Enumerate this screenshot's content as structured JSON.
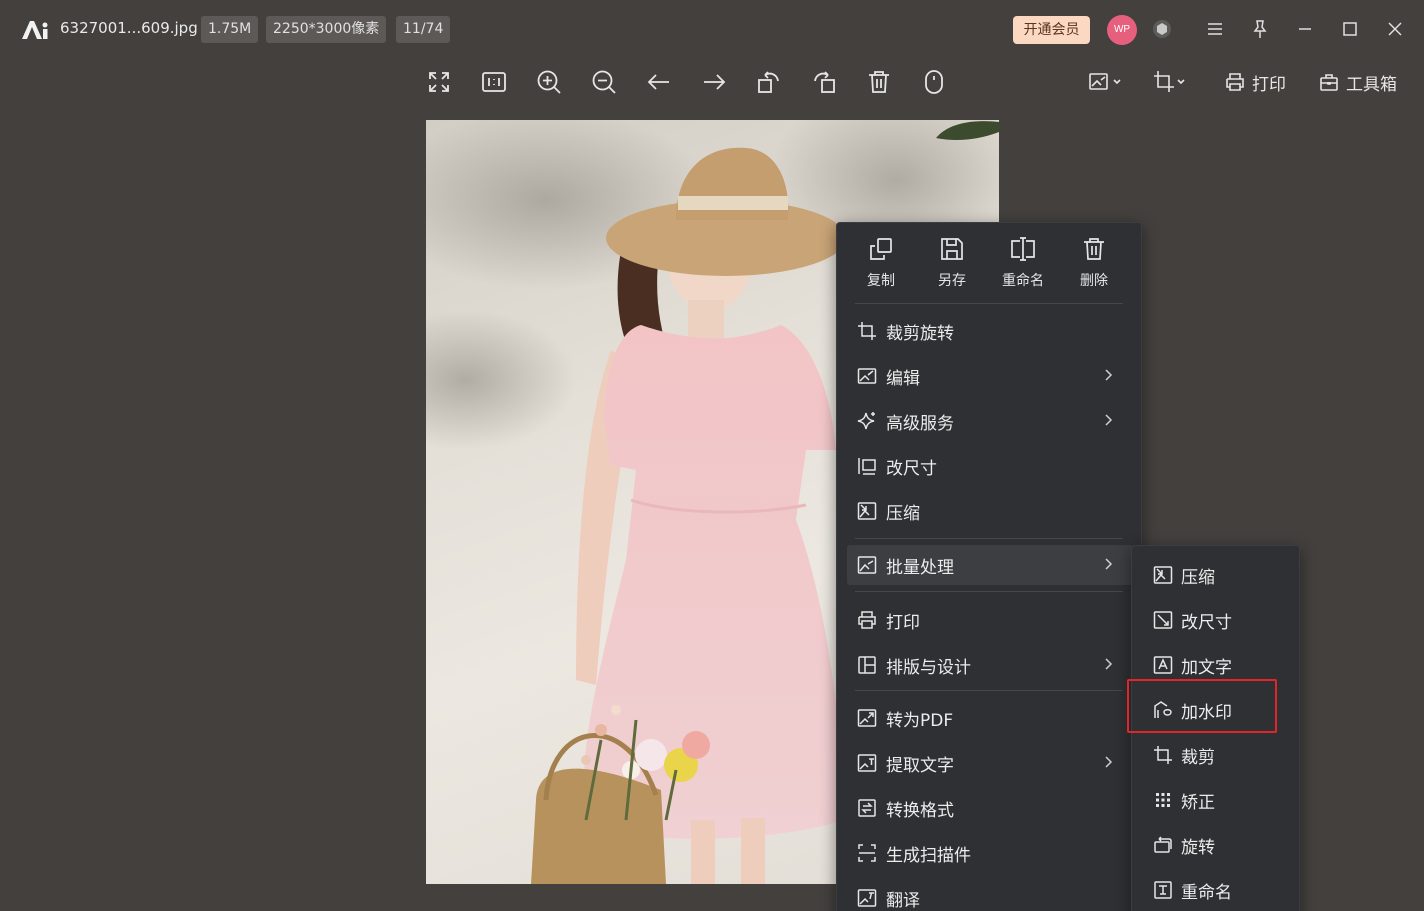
{
  "titlebar": {
    "filename": "6327001...609.jpg",
    "file_size": "1.75M",
    "dimensions": "2250*3000像素",
    "position": "11/74",
    "vip_button": "开通会员",
    "avatar_text": "WP"
  },
  "toolbar": {
    "print_label": "打印",
    "toolbox_label": "工具箱"
  },
  "context_menu": {
    "quick_actions": [
      {
        "label": "复制",
        "icon": "copy-icon"
      },
      {
        "label": "另存",
        "icon": "save-as-icon"
      },
      {
        "label": "重命名",
        "icon": "rename-icon"
      },
      {
        "label": "删除",
        "icon": "delete-icon"
      }
    ],
    "items": [
      {
        "label": "裁剪旋转",
        "icon": "crop-rotate-icon",
        "has_submenu": false
      },
      {
        "label": "编辑",
        "icon": "edit-image-icon",
        "has_submenu": true
      },
      {
        "label": "高级服务",
        "icon": "sparkle-icon",
        "has_submenu": true
      },
      {
        "label": "改尺寸",
        "icon": "resize-icon",
        "has_submenu": false
      },
      {
        "label": "压缩",
        "icon": "compress-icon",
        "has_submenu": false
      },
      {
        "label": "批量处理",
        "icon": "batch-icon",
        "has_submenu": true
      },
      {
        "label": "打印",
        "icon": "print-icon",
        "has_submenu": false
      },
      {
        "label": "排版与设计",
        "icon": "layout-icon",
        "has_submenu": true
      },
      {
        "label": "转为PDF",
        "icon": "to-pdf-icon",
        "has_submenu": false
      },
      {
        "label": "提取文字",
        "icon": "extract-text-icon",
        "has_submenu": true
      },
      {
        "label": "转换格式",
        "icon": "convert-format-icon",
        "has_submenu": false
      },
      {
        "label": "生成扫描件",
        "icon": "scan-icon",
        "has_submenu": false
      },
      {
        "label": "翻译",
        "icon": "translate-icon",
        "has_submenu": false
      }
    ]
  },
  "submenu": {
    "items": [
      {
        "label": "压缩",
        "icon": "compress-icon"
      },
      {
        "label": "改尺寸",
        "icon": "resize-icon"
      },
      {
        "label": "加文字",
        "icon": "add-text-icon"
      },
      {
        "label": "加水印",
        "icon": "watermark-icon"
      },
      {
        "label": "裁剪",
        "icon": "crop-icon"
      },
      {
        "label": "矫正",
        "icon": "correct-icon"
      },
      {
        "label": "旋转",
        "icon": "rotate-icon"
      },
      {
        "label": "重命名",
        "icon": "rename-icon"
      }
    ]
  },
  "colors": {
    "background": "#43403e",
    "menu_bg": "#2f3033",
    "vip_bg": "#fbd8c2",
    "highlight_box": "#e0262b"
  }
}
